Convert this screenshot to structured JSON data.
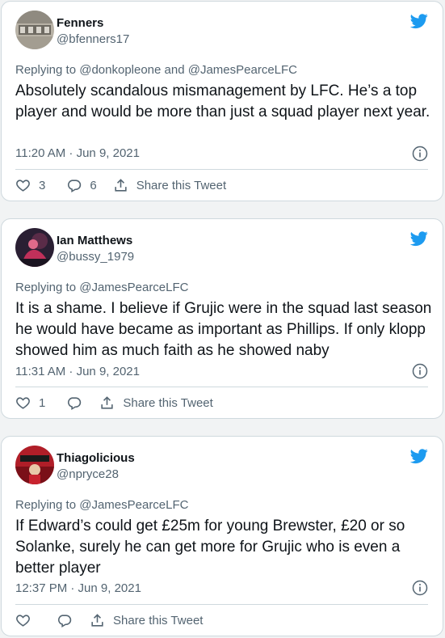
{
  "colors": {
    "brand": "#1d9bf0",
    "muted": "#536471",
    "text": "#0f1419",
    "border": "#cfd9de"
  },
  "tweets": [
    {
      "name": "Fenners",
      "handle": "@bfenners17",
      "replying_prefix": "Replying to",
      "mention1": "@donkopleone",
      "joiner": "and",
      "mention2": "@JamesPearceLFC",
      "text": "Absolutely scandalous mismanagement by LFC. He’s a top player and would be more than just a squad player next year.",
      "time": "11:20 AM · Jun 9, 2021",
      "likes": "3",
      "replies": "6",
      "share": "Share this Tweet"
    },
    {
      "name": "Ian Matthews",
      "handle": "@bussy_1979",
      "replying_prefix": "Replying to",
      "mention1": "@JamesPearceLFC",
      "text": "It is a shame. I believe if Grujic were in the squad last season he would have became as important as Phillips. If only klopp showed him as much faith as he showed naby",
      "time": "11:31 AM · Jun 9, 2021",
      "likes": "1",
      "share": "Share this Tweet"
    },
    {
      "name": "Thiagolicious",
      "handle": "@npryce28",
      "replying_prefix": "Replying to",
      "mention1": "@JamesPearceLFC",
      "text": "If Edward’s could get £25m for young Brewster, £20 or so Solanke, surely he can get more for Grujic who is even a better player",
      "time": "12:37 PM · Jun 9, 2021",
      "share": "Share this Tweet"
    }
  ]
}
